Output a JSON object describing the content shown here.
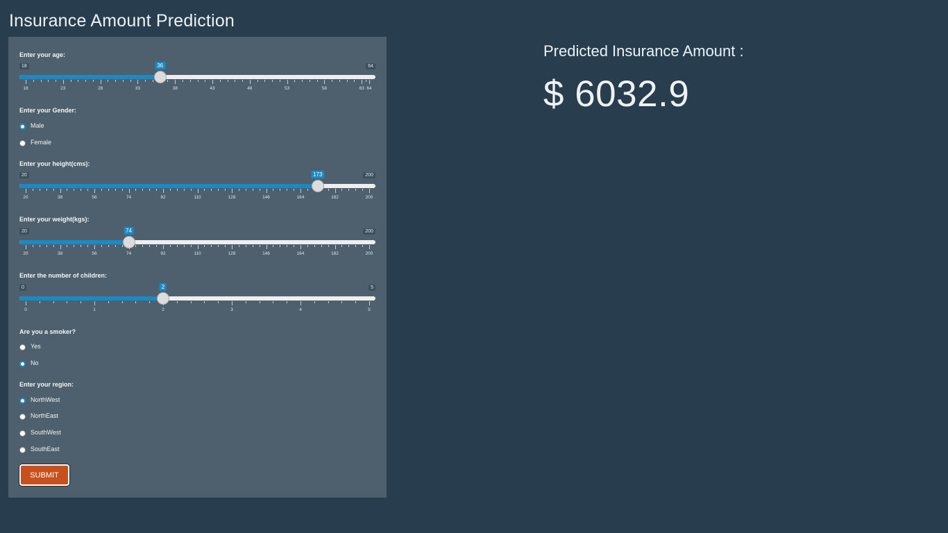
{
  "page_title": "Insurance Amount Prediction",
  "colors": {
    "background": "#283d4d",
    "panel": "#4e606d",
    "accent": "#1a8ac6",
    "submit": "#c6501e"
  },
  "form": {
    "age": {
      "label": "Enter your age:",
      "min": 18,
      "max": 64,
      "value": 36,
      "min_label": "18",
      "max_label": "64",
      "major_ticks": [
        18,
        23,
        28,
        33,
        38,
        43,
        48,
        53,
        58,
        63,
        64
      ]
    },
    "gender": {
      "label": "Enter your Gender:",
      "options": [
        "Male",
        "Female"
      ],
      "selected": "Male"
    },
    "height": {
      "label": "Enter your height(cms):",
      "min": 20,
      "max": 200,
      "value": 173,
      "min_label": "20",
      "max_label": "200",
      "major_ticks": [
        20,
        38,
        56,
        74,
        92,
        110,
        128,
        146,
        164,
        182,
        200
      ]
    },
    "weight": {
      "label": "Enter your weight(kgs):",
      "min": 20,
      "max": 200,
      "value": 74,
      "min_label": "20",
      "max_label": "200",
      "major_ticks": [
        20,
        38,
        56,
        74,
        92,
        110,
        128,
        146,
        164,
        182,
        200
      ]
    },
    "children": {
      "label": "Enter the number of children:",
      "min": 0,
      "max": 5,
      "value": 2,
      "min_label": "0",
      "max_label": "5",
      "major_ticks": [
        0,
        1,
        2,
        3,
        4,
        5
      ]
    },
    "smoker": {
      "label": "Are you a smoker?",
      "options": [
        "Yes",
        "No"
      ],
      "selected": "No"
    },
    "region": {
      "label": "Enter your region:",
      "options": [
        "NorthWest",
        "NorthEast",
        "SouthWest",
        "SouthEast"
      ],
      "selected": "NorthWest"
    },
    "submit_label": "SUBMIT"
  },
  "result": {
    "label": "Predicted Insurance Amount :",
    "value": "$ 6032.9"
  }
}
